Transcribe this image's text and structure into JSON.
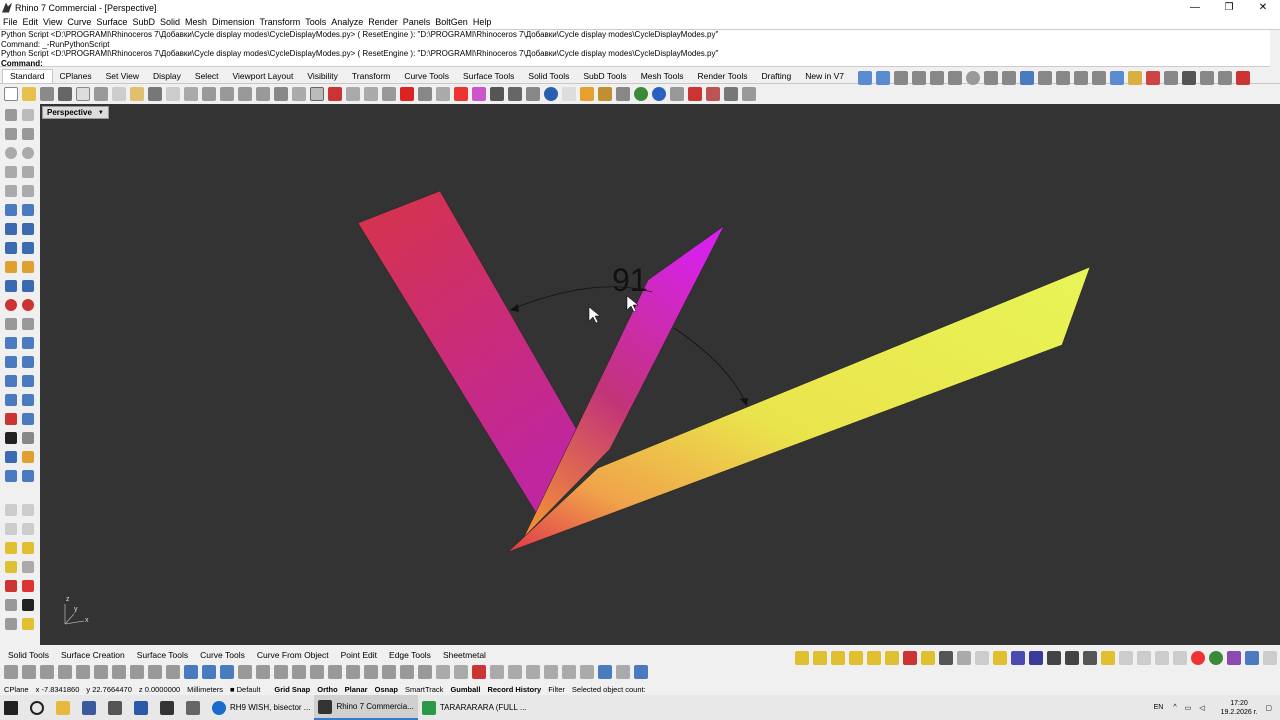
{
  "window": {
    "title": "Rhino 7 Commercial - [Perspective]",
    "controls": [
      "—",
      "❐",
      "✕"
    ]
  },
  "menu": [
    "File",
    "Edit",
    "View",
    "Curve",
    "Surface",
    "SubD",
    "Solid",
    "Mesh",
    "Dimension",
    "Transform",
    "Tools",
    "Analyze",
    "Render",
    "Panels",
    "BoltGen",
    "Help"
  ],
  "command_history": {
    "lines": [
      "Python Script <D:\\PROGRAMI\\Rhinoceros 7\\Добавки\\Cycle display modes\\CycleDisplayModes.py> ( ResetEngine ): \"D:\\PROGRAMI\\Rhinoceros 7\\Добавки\\Cycle display modes\\CycleDisplayModes.py\"",
      "Command: _-RunPythonScript",
      "Python Script <D:\\PROGRAMI\\Rhinoceros 7\\Добавки\\Cycle display modes\\CycleDisplayModes.py> ( ResetEngine ): \"D:\\PROGRAMI\\Rhinoceros 7\\Добавки\\Cycle display modes\\CycleDisplayModes.py\""
    ],
    "prompt": "Command:"
  },
  "toolbar_tabs": [
    "Standard",
    "CPlanes",
    "Set View",
    "Display",
    "Select",
    "Viewport Layout",
    "Visibility",
    "Transform",
    "Curve Tools",
    "Surface Tools",
    "Solid Tools",
    "SubD Tools",
    "Mesh Tools",
    "Render Tools",
    "Drafting",
    "New in V7"
  ],
  "viewport": {
    "name": "Perspective",
    "angle_label": "91",
    "axes": {
      "x": "x",
      "y": "y",
      "z": "z"
    }
  },
  "bottom_tabs": [
    "Solid Tools",
    "Surface Creation",
    "Surface Tools",
    "Curve Tools",
    "Curve From Object",
    "Point Edit",
    "Edge Tools",
    "Sheetmetal"
  ],
  "status": {
    "cplane": "CPlane",
    "x": "x -7.8341860",
    "y": "y 22.7664470",
    "z": "z 0.0000000",
    "units": "Millimeters",
    "layer": "Default",
    "grid_snap": "Grid Snap",
    "ortho": "Ortho",
    "planar": "Planar",
    "osnap": "Osnap",
    "smarttrack": "SmartTrack",
    "gumball": "Gumball",
    "record_history": "Record History",
    "filter": "Filter",
    "selected": "Selected object count:"
  },
  "taskbar": {
    "items": [
      "RH9 WISH, bisector ...",
      "Rhino 7 Commercia...",
      "TARARARARA (FULL ..."
    ],
    "lang": "EN",
    "time": "17:20",
    "date": "19.2.2026 г."
  },
  "colors": {
    "viewport_bg": "#333333",
    "taskbar_accent": "#3a78c9"
  }
}
